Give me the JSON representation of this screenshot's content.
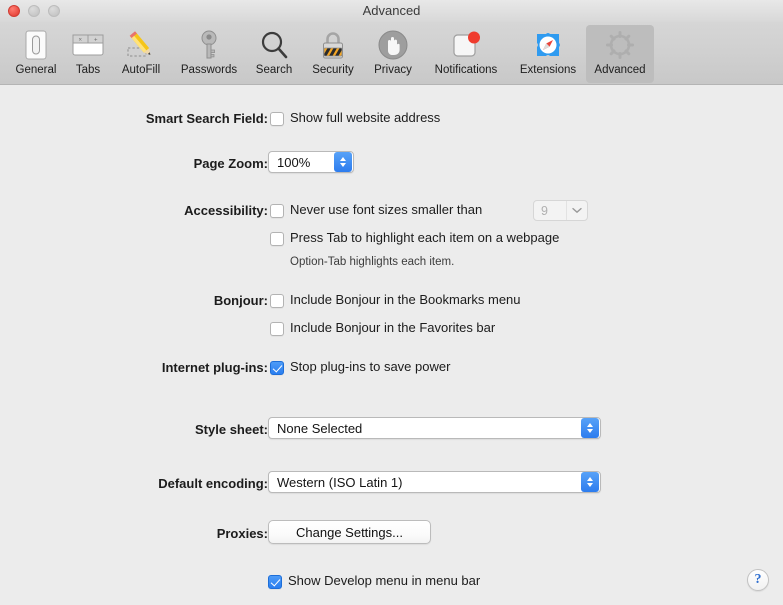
{
  "window": {
    "title": "Advanced",
    "traffic_lights": [
      {
        "name": "close",
        "active": true
      },
      {
        "name": "minimize",
        "active": false
      },
      {
        "name": "zoom",
        "active": false
      }
    ]
  },
  "toolbar": {
    "items": [
      {
        "label": "General",
        "icon": "general-icon",
        "selected": false
      },
      {
        "label": "Tabs",
        "icon": "tabs-icon",
        "selected": false
      },
      {
        "label": "AutoFill",
        "icon": "autofill-pencil-icon",
        "selected": false
      },
      {
        "label": "Passwords",
        "icon": "key-icon",
        "selected": false
      },
      {
        "label": "Search",
        "icon": "magnifier-icon",
        "selected": false
      },
      {
        "label": "Security",
        "icon": "padlock-icon",
        "selected": false
      },
      {
        "label": "Privacy",
        "icon": "hand-icon",
        "selected": false
      },
      {
        "label": "Notifications",
        "icon": "notification-badge-icon",
        "selected": false
      },
      {
        "label": "Extensions",
        "icon": "puzzle-compass-icon",
        "selected": false
      },
      {
        "label": "Advanced",
        "icon": "gear-icon",
        "selected": true
      }
    ]
  },
  "settings": {
    "smart_search_field": {
      "label": "Smart Search Field:",
      "checkbox_label": "Show full website address",
      "checked": false
    },
    "page_zoom": {
      "label": "Page Zoom:",
      "value": "100%"
    },
    "accessibility": {
      "label": "Accessibility:",
      "min_font_label": "Never use font sizes smaller than",
      "min_font_checked": false,
      "min_font_value": "9",
      "min_font_enabled": false,
      "press_tab_label": "Press Tab to highlight each item on a webpage",
      "press_tab_checked": false,
      "hint": "Option-Tab highlights each item."
    },
    "bonjour": {
      "label": "Bonjour:",
      "bookmarks_label": "Include Bonjour in the Bookmarks menu",
      "bookmarks_checked": false,
      "favorites_label": "Include Bonjour in the Favorites bar",
      "favorites_checked": false
    },
    "internet_plugins": {
      "label": "Internet plug-ins:",
      "checkbox_label": "Stop plug-ins to save power",
      "checked": true
    },
    "style_sheet": {
      "label": "Style sheet:",
      "value": "None Selected"
    },
    "default_encoding": {
      "label": "Default encoding:",
      "value": "Western (ISO Latin 1)"
    },
    "proxies": {
      "label": "Proxies:",
      "button_label": "Change Settings..."
    },
    "develop_menu": {
      "checkbox_label": "Show Develop menu in menu bar",
      "checked": true
    }
  },
  "help": {
    "glyph": "?"
  },
  "colors": {
    "accent_blue": "#2d7cee",
    "window_bg": "#ececec",
    "toolbar_selected": "#bdbdbd",
    "close_red": "#e8473d"
  }
}
